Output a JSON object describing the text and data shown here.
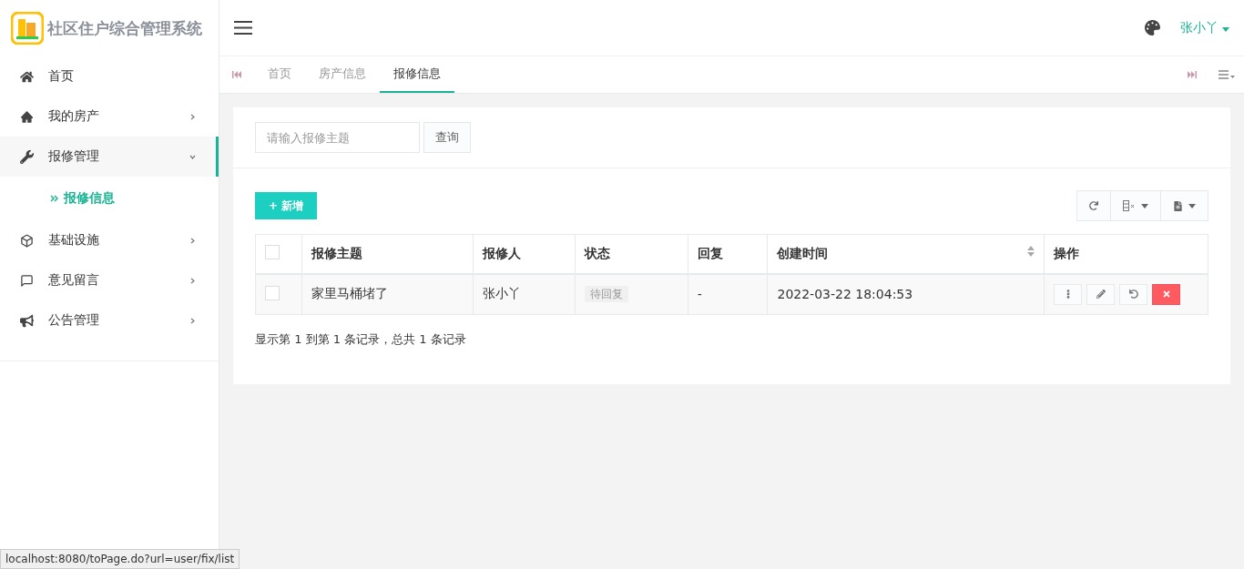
{
  "app": {
    "title": "社区住户综合管理系统"
  },
  "header": {
    "user": "张小丫"
  },
  "sidebar": {
    "items": [
      {
        "label": "首页",
        "selected": false
      },
      {
        "label": "我的房产",
        "expanded": false,
        "selected": false
      },
      {
        "label": "报修管理",
        "expanded": true,
        "selected": true,
        "children": [
          {
            "label": "报修信息",
            "selected": true
          }
        ]
      },
      {
        "label": "基础设施",
        "expanded": false,
        "selected": false
      },
      {
        "label": "意见留言",
        "expanded": false,
        "selected": false
      },
      {
        "label": "公告管理",
        "expanded": false,
        "selected": false
      }
    ]
  },
  "tabs": [
    {
      "label": "首页",
      "selected": false
    },
    {
      "label": "房产信息",
      "selected": false
    },
    {
      "label": "报修信息",
      "selected": true
    }
  ],
  "search": {
    "placeholder": "请输入报修主题",
    "button": "查询"
  },
  "add_button": "+ 新增",
  "table": {
    "all_checked": false,
    "columns": [
      {
        "label": "报修主题",
        "sortable": false
      },
      {
        "label": "报修人",
        "sortable": false
      },
      {
        "label": "状态",
        "sortable": false
      },
      {
        "label": "回复",
        "sortable": false
      },
      {
        "label": "创建时间",
        "sortable": true
      },
      {
        "label": "操作",
        "sortable": false
      }
    ],
    "rows": [
      {
        "checked": false,
        "cells": [
          "家里马桶堵了",
          "张小丫",
          "待回复",
          "-",
          "2022-03-22 18:04:53"
        ]
      }
    ]
  },
  "pagination": "显示第 1 到第 1 条记录，总共 1 条记录",
  "status_bar": "localhost:8080/toPage.do?url=user/fix/list"
}
